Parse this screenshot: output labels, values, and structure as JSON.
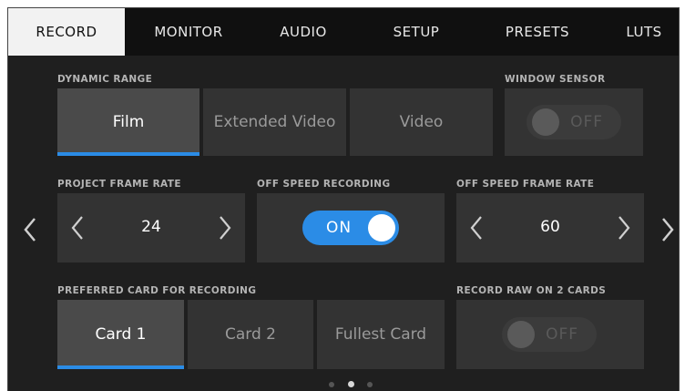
{
  "tabs": [
    {
      "label": "RECORD",
      "active": true
    },
    {
      "label": "MONITOR",
      "active": false
    },
    {
      "label": "AUDIO",
      "active": false
    },
    {
      "label": "SETUP",
      "active": false
    },
    {
      "label": "PRESETS",
      "active": false
    },
    {
      "label": "LUTS",
      "active": false
    }
  ],
  "dynamic_range": {
    "label": "DYNAMIC RANGE",
    "options": [
      "Film",
      "Extended Video",
      "Video"
    ],
    "selected": "Film"
  },
  "window_sensor": {
    "label": "WINDOW SENSOR",
    "state": "OFF"
  },
  "project_frame_rate": {
    "label": "PROJECT FRAME RATE",
    "value": "24"
  },
  "off_speed_recording": {
    "label": "OFF SPEED RECORDING",
    "state": "ON"
  },
  "off_speed_frame_rate": {
    "label": "OFF SPEED FRAME RATE",
    "value": "60"
  },
  "preferred_card": {
    "label": "PREFERRED CARD FOR RECORDING",
    "options": [
      "Card 1",
      "Card 2",
      "Fullest Card"
    ],
    "selected": "Card 1"
  },
  "record_raw_2_cards": {
    "label": "RECORD RAW ON 2 CARDS",
    "state": "OFF"
  },
  "pagination": {
    "pages": 3,
    "current": 2
  },
  "icons": {
    "page_prev": "chevron-left-icon",
    "page_next": "chevron-right-icon",
    "stepper_decrement": "chevron-left-icon",
    "stepper_increment": "chevron-right-icon"
  },
  "colors": {
    "accent": "#2b8ce6",
    "background": "#1f1f1f",
    "tab_bar": "#101010",
    "active_tab": "#f2f2f2"
  }
}
